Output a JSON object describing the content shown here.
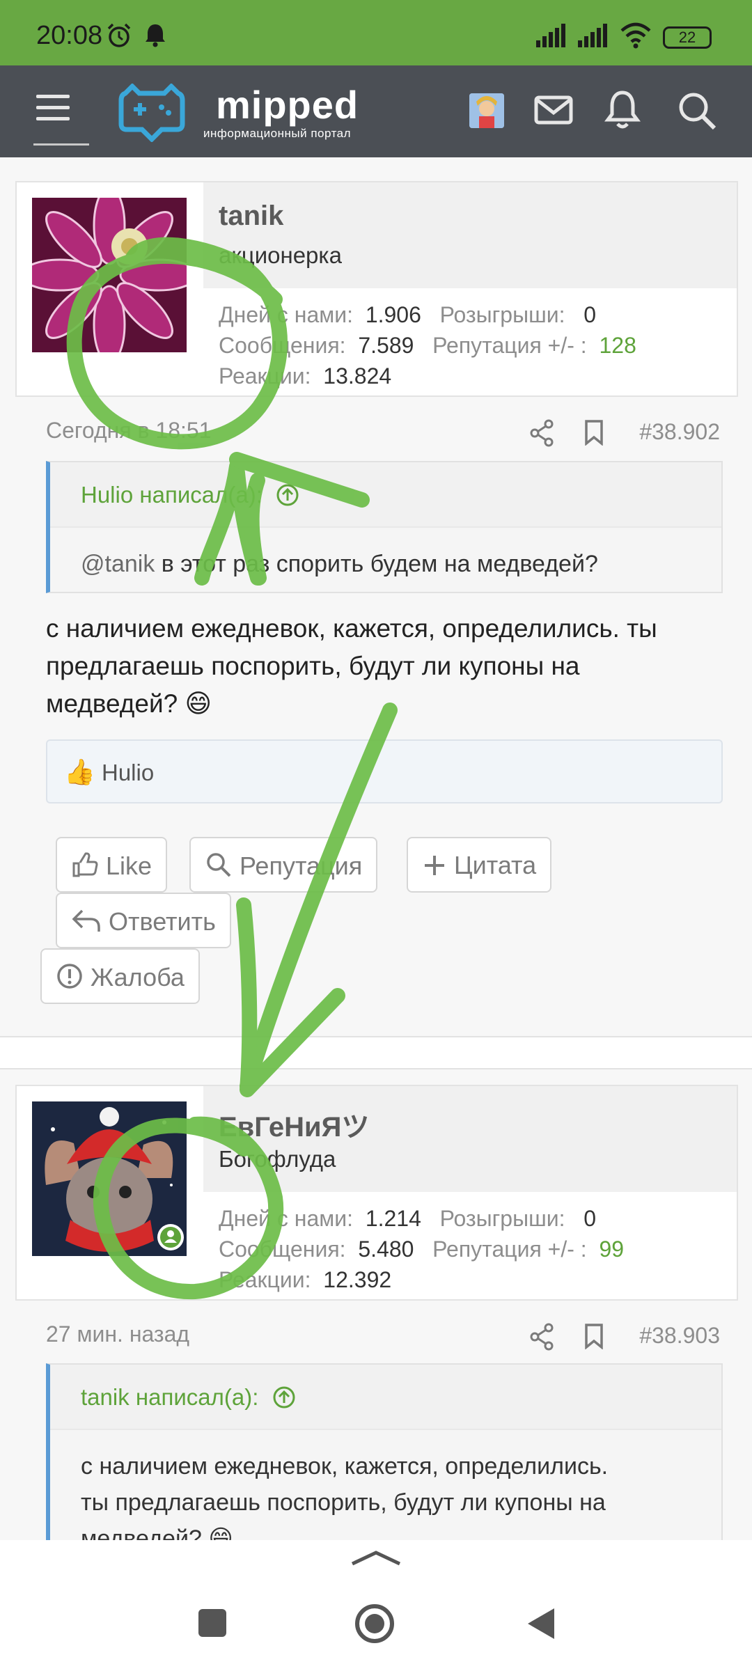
{
  "status": {
    "time": "20:08",
    "battery": "22",
    "icons": [
      "alarm-icon",
      "notification-bell-icon",
      "signal-icon",
      "signal-icon",
      "wifi-icon",
      "battery-icon"
    ]
  },
  "header": {
    "logo_word": "mipped",
    "logo_sub": "информационный портал",
    "icons": [
      "menu-icon",
      "user-avatar",
      "mail-icon",
      "bell-icon",
      "search-icon"
    ]
  },
  "colors": {
    "brand_green": "#68a843",
    "header_bg": "#4b4f55",
    "accent_green": "#5ea33a",
    "quote_border": "#5b9bd5"
  },
  "posts": [
    {
      "username": "tanik",
      "user_title": "акционерка",
      "stats": {
        "days_label": "Дней с нами:",
        "days": "1.906",
        "giveaways_label": "Розыгрыши:",
        "giveaways": "0",
        "messages_label": "Сообщения:",
        "messages": "7.589",
        "rep_label": "Репутация +/- :",
        "rep": "128",
        "reactions_label": "Реакции:",
        "reactions": "13.824"
      },
      "time": "Сегодня в 18:51",
      "number": "#38.902",
      "quote_author": "Hulio написал(а):",
      "quote_mention": "@tanik",
      "quote_text": " в этот раз спорить будем на медведей?",
      "text_lines": [
        "с наличием ежедневок, кажется, определились. ты",
        "предлагаешь поспорить, будут ли купоны на",
        "медведей? 😄"
      ],
      "likes": "Hulio",
      "buttons": {
        "like": "Like",
        "rep": "Репутация",
        "quote": "Цитата",
        "reply": "Ответить",
        "report": "Жалоба"
      }
    },
    {
      "username": "ЕвГеНиЯツ",
      "user_title": "Богофлуда",
      "stats": {
        "days_label": "Дней с нами:",
        "days": "1.214",
        "giveaways_label": "Розыгрыши:",
        "giveaways": "0",
        "messages_label": "Сообщения:",
        "messages": "5.480",
        "rep_label": "Репутация +/- :",
        "rep": "99",
        "reactions_label": "Реакции:",
        "reactions": "12.392"
      },
      "time": "27 мин. назад",
      "number": "#38.903",
      "quote_author": "tanik написал(а):",
      "quote_lines": [
        "с наличием ежедневок, кажется, определились.",
        "ты предлагаешь поспорить, будут ли купоны на",
        "медведей? 😄"
      ]
    }
  ]
}
